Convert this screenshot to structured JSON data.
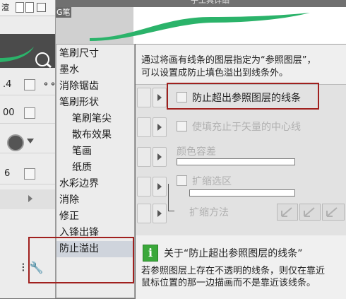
{
  "left_panel": {
    "tab_text": "渲",
    "row_values": [
      ".4",
      "00",
      "6"
    ]
  },
  "dialog": {
    "preview_label": "G笔",
    "title": "子工具详细"
  },
  "categories": [
    {
      "label": "笔刷尺寸",
      "sub": false,
      "selected": false
    },
    {
      "label": "墨水",
      "sub": false,
      "selected": false
    },
    {
      "label": "消除锯齿",
      "sub": false,
      "selected": false
    },
    {
      "label": "笔刷形状",
      "sub": false,
      "selected": false
    },
    {
      "label": "笔刷笔尖",
      "sub": true,
      "selected": false
    },
    {
      "label": "散布效果",
      "sub": true,
      "selected": false
    },
    {
      "label": "笔画",
      "sub": true,
      "selected": false
    },
    {
      "label": "纸质",
      "sub": true,
      "selected": false
    },
    {
      "label": "水彩边界",
      "sub": false,
      "selected": false
    },
    {
      "label": "消除",
      "sub": false,
      "selected": false
    },
    {
      "label": "修正",
      "sub": false,
      "selected": false
    },
    {
      "label": "入锋出锋",
      "sub": false,
      "selected": false
    },
    {
      "label": "防止溢出",
      "sub": false,
      "selected": true
    }
  ],
  "pane": {
    "description_line1": "通过将画有线条的图层指定为“参照图层”，",
    "description_line2": "可以设置成防止填色溢出到线条外。",
    "options": {
      "prevent_overflow": "防止超出参照图层的线条",
      "fill_to_vector_center": "使填充止于矢量的中心线",
      "color_tolerance": "颜色容差",
      "expand_selection": "扩缩选区",
      "expand_method": "扩缩方法"
    },
    "help_title": "关于“防止超出参照图层的线条”",
    "help_line1": "若参照图层上存在不透明的线条，则仅在靠近",
    "help_line2": "鼠标位置的那一边描画而不是靠近该线条。"
  },
  "colors": {
    "stroke_green": "#2bb36a",
    "highlight_red": "#a0201e",
    "info_green": "#3aa83a"
  }
}
